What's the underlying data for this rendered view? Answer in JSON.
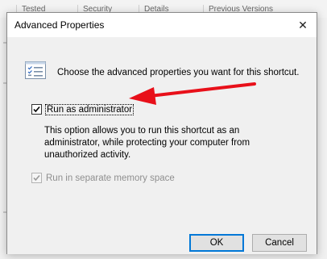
{
  "background_window": {
    "columns": [
      "Tested",
      "Security",
      "Details",
      "Previous Versions"
    ]
  },
  "dialog": {
    "title": "Advanced Properties",
    "close_glyph": "✕",
    "intro_text": "Choose the advanced properties you want for this shortcut.",
    "run_as_admin": {
      "label": "Run as administrator",
      "checked": true,
      "description": "This option allows you to run this shortcut as an administrator, while protecting your computer from unauthorized activity."
    },
    "separate_memory": {
      "label": "Run in separate memory space",
      "checked": true,
      "enabled": false
    },
    "buttons": {
      "ok": "OK",
      "cancel": "Cancel"
    }
  },
  "annotation": {
    "type": "arrow",
    "color": "#e8101a"
  },
  "colors": {
    "focus_border": "#0078d7",
    "dialog_bg": "#f0f0f0"
  }
}
